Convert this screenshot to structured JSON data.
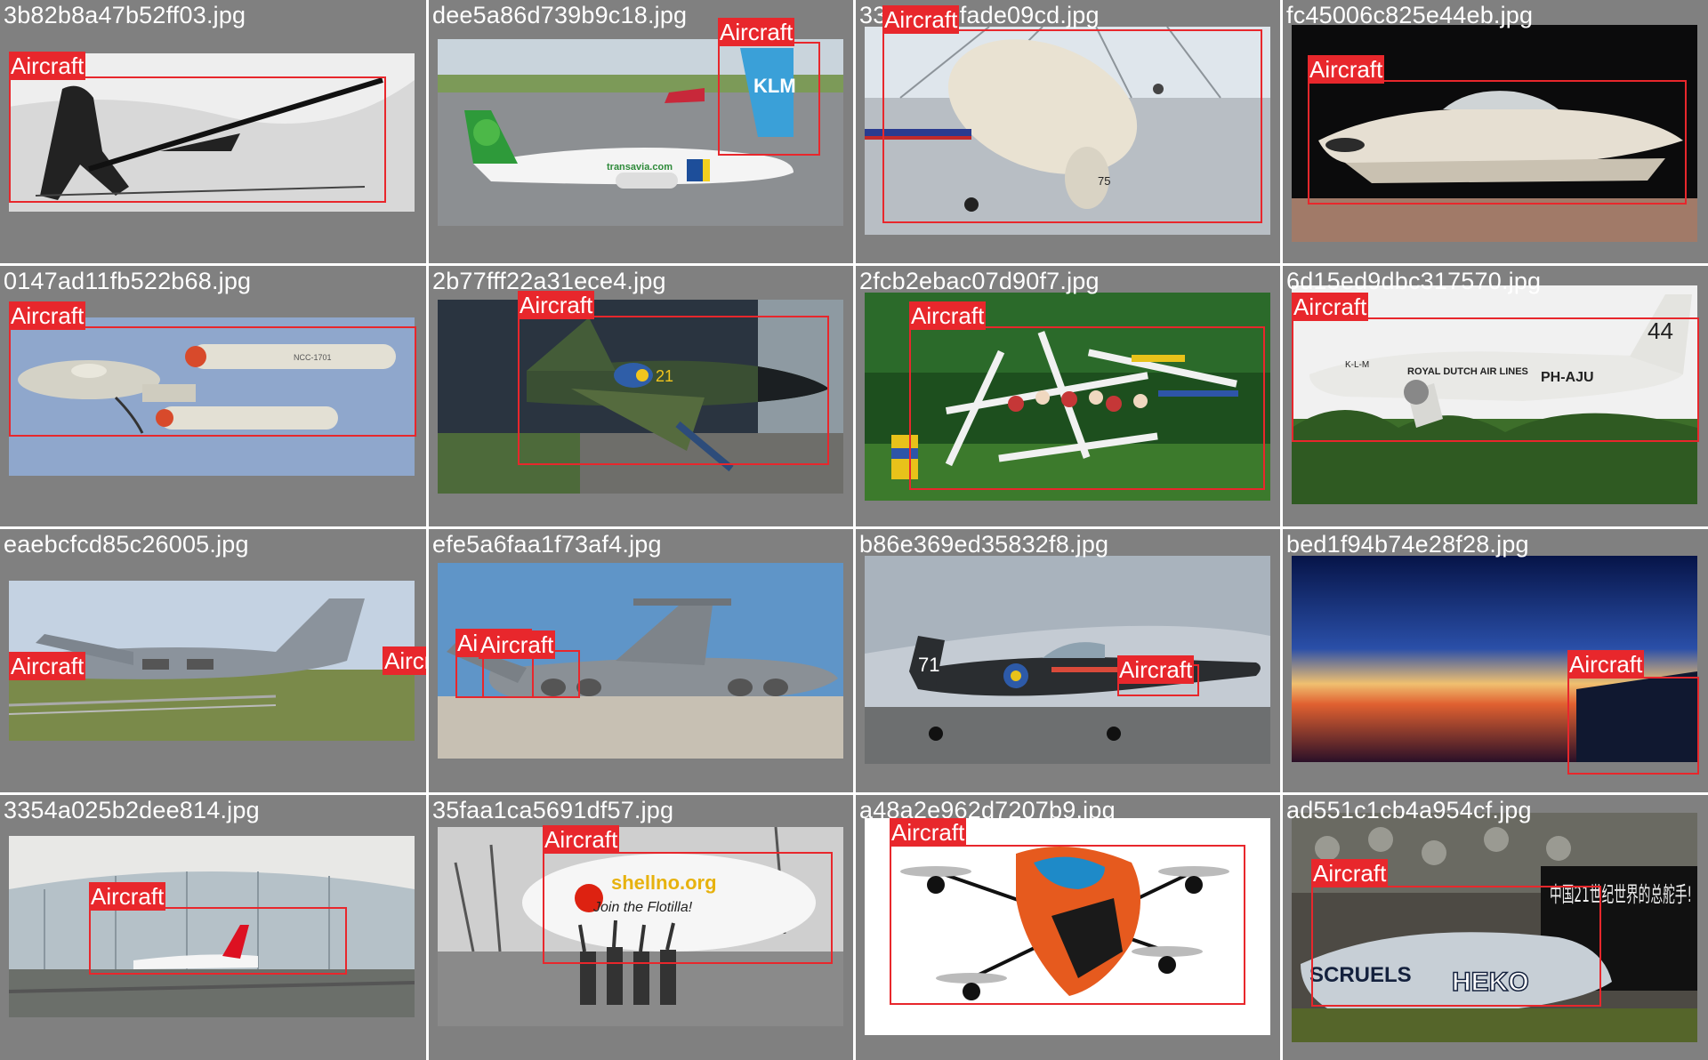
{
  "box_color": "#e8272c",
  "tiles": [
    {
      "filename": "3b82b8a47b52ff03.jpg",
      "label": "Aircraft",
      "scene": "gunner-bw"
    },
    {
      "filename": "dee5a86d739b9c18.jpg",
      "label": "Aircraft",
      "scene": "airport-transavia"
    },
    {
      "filename": "33bd1f2cfade09cd.jpg",
      "label": "Aircraft",
      "scene": "museum-flyingwing"
    },
    {
      "filename": "fc45006c825e44eb.jpg",
      "label": "Aircraft",
      "scene": "hovercraft-dark"
    },
    {
      "filename": "0147ad11fb522b68.jpg",
      "label": "Aircraft",
      "scene": "starship-model"
    },
    {
      "filename": "2b77fff22a31ece4.jpg",
      "label": "Aircraft",
      "scene": "jet-hangar"
    },
    {
      "filename": "2fcb2ebac07d90f7.jpg",
      "label": "Aircraft",
      "scene": "model-club"
    },
    {
      "filename": "6d15ed9dbc317570.jpg",
      "label": "Aircraft",
      "scene": "dc2-trees"
    },
    {
      "filename": "eaebcfcd85c26005.jpg",
      "label": "Aircraft",
      "scene": "c17-field"
    },
    {
      "filename": "efe5a6faa1f73af4.jpg",
      "label": "Aircraft",
      "scene": "galaxy-tarmac"
    },
    {
      "filename": "b86e369ed35832f8.jpg",
      "label": "Aircraft",
      "scene": "trainer-runway"
    },
    {
      "filename": "bed1f94b74e28f28.jpg",
      "label": "Aircraft",
      "scene": "sunset-wing"
    },
    {
      "filename": "3354a025b2dee814.jpg",
      "label": "Aircraft",
      "scene": "terminal-emirates"
    },
    {
      "filename": "35faa1ca5691df57.jpg",
      "label": "Aircraft",
      "scene": "blimp-protest"
    },
    {
      "filename": "a48a2e962d7207b9.jpg",
      "label": "Aircraft",
      "scene": "drone-white"
    },
    {
      "filename": "ad551c1cb4a954cf.jpg",
      "label": "Aircraft",
      "scene": "graffiti-wreck"
    }
  ],
  "photo_text": {
    "transavia_livery": "transavia.com",
    "klm_tail": "KLM",
    "ncc_registry": "NCC-1701",
    "dc2_tail": "44",
    "dc2_reg": "PH-AJU",
    "dc2_line": "ROYAL DUTCH AIR LINES",
    "klm_nose": "K-L-M",
    "jet_number": "21",
    "trainer_number": "71",
    "museum_number": "75",
    "blimp_url": "shellno.org",
    "blimp_tagline": "Join the Flotilla!",
    "graffiti_chinese": "中国21世纪世界的总舵手!",
    "graffiti_word": "SCRUELS",
    "graffiti_tag": "HEKO"
  }
}
